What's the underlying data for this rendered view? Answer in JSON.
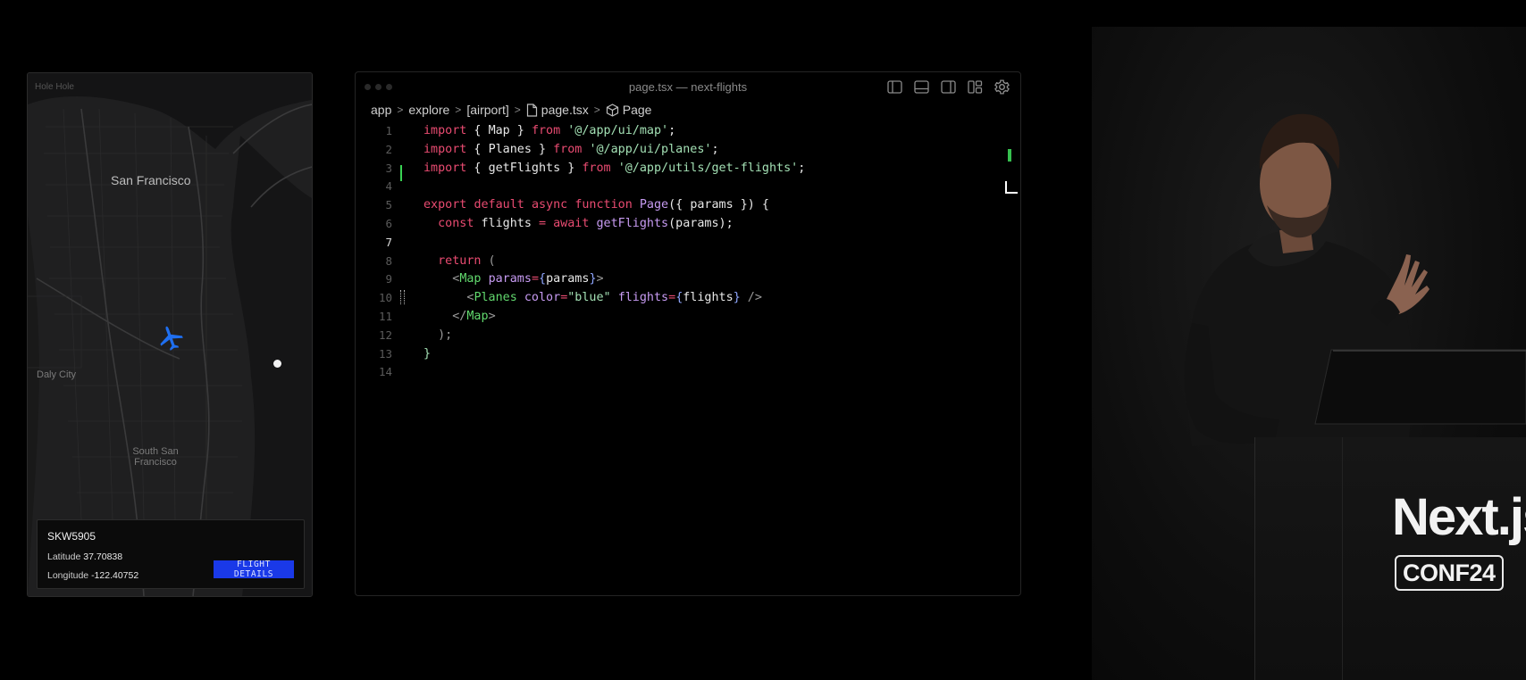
{
  "map": {
    "corner_label": "Hole Hole",
    "city_sf": "San Francisco",
    "city_daly": "Daly City",
    "city_ssf": "South San Francisco",
    "plane_icon": "airplane-icon",
    "flight": {
      "id": "SKW5905",
      "latitude_label": "Latitude",
      "latitude_value": "37.70838",
      "longitude_label": "Longitude",
      "longitude_value": "-122.40752",
      "details_button": "FLIGHT DETAILS"
    }
  },
  "editor": {
    "title": "page.tsx — next-flights",
    "layout_icons": [
      "sidebar-left-icon",
      "panel-bottom-icon",
      "sidebar-right-icon",
      "layout-customize-icon",
      "gear-icon"
    ],
    "breadcrumb": {
      "seg1": "app",
      "seg2": "explore",
      "seg3": "[airport]",
      "seg4": "page.tsx",
      "seg5": "Page"
    },
    "current_line": 7,
    "lines": [
      {
        "n": "1",
        "tokens": [
          {
            "t": "import",
            "c": "kw"
          },
          {
            "t": " { ",
            "c": "plain"
          },
          {
            "t": "Map",
            "c": "plain"
          },
          {
            "t": " } ",
            "c": "plain"
          },
          {
            "t": "from",
            "c": "kw"
          },
          {
            "t": " ",
            "c": "plain"
          },
          {
            "t": "'@/app/ui/map'",
            "c": "str"
          },
          {
            "t": ";",
            "c": "plain"
          }
        ]
      },
      {
        "n": "2",
        "tokens": [
          {
            "t": "import",
            "c": "kw"
          },
          {
            "t": " { ",
            "c": "plain"
          },
          {
            "t": "Planes",
            "c": "plain"
          },
          {
            "t": " } ",
            "c": "plain"
          },
          {
            "t": "from",
            "c": "kw"
          },
          {
            "t": " ",
            "c": "plain"
          },
          {
            "t": "'@/app/ui/planes'",
            "c": "str"
          },
          {
            "t": ";",
            "c": "plain"
          }
        ]
      },
      {
        "n": "3",
        "tokens": [
          {
            "t": "import",
            "c": "kw"
          },
          {
            "t": " { ",
            "c": "plain"
          },
          {
            "t": "getFlights",
            "c": "plain"
          },
          {
            "t": " } ",
            "c": "plain"
          },
          {
            "t": "from",
            "c": "kw"
          },
          {
            "t": " ",
            "c": "plain"
          },
          {
            "t": "'@/app/utils/get-flights'",
            "c": "str"
          },
          {
            "t": ";",
            "c": "plain"
          }
        ]
      },
      {
        "n": "4",
        "tokens": []
      },
      {
        "n": "5",
        "tokens": [
          {
            "t": "export",
            "c": "kw"
          },
          {
            "t": " ",
            "c": "plain"
          },
          {
            "t": "default",
            "c": "kw"
          },
          {
            "t": " ",
            "c": "plain"
          },
          {
            "t": "async",
            "c": "kw"
          },
          {
            "t": " ",
            "c": "plain"
          },
          {
            "t": "function",
            "c": "kw"
          },
          {
            "t": " ",
            "c": "plain"
          },
          {
            "t": "Page",
            "c": "fn"
          },
          {
            "t": "({ ",
            "c": "plain"
          },
          {
            "t": "params",
            "c": "plain"
          },
          {
            "t": " }) {",
            "c": "plain"
          }
        ]
      },
      {
        "n": "6",
        "tokens": [
          {
            "t": "  ",
            "c": "plain"
          },
          {
            "t": "const",
            "c": "kw"
          },
          {
            "t": " flights ",
            "c": "plain"
          },
          {
            "t": "=",
            "c": "kw"
          },
          {
            "t": " ",
            "c": "plain"
          },
          {
            "t": "await",
            "c": "kw"
          },
          {
            "t": " ",
            "c": "plain"
          },
          {
            "t": "getFlights",
            "c": "fn"
          },
          {
            "t": "(params);",
            "c": "plain"
          }
        ]
      },
      {
        "n": "7",
        "tokens": []
      },
      {
        "n": "8",
        "tokens": [
          {
            "t": "  ",
            "c": "plain"
          },
          {
            "t": "return",
            "c": "kw"
          },
          {
            "t": " (",
            "c": "dim"
          }
        ]
      },
      {
        "n": "9",
        "tokens": [
          {
            "t": "    <",
            "c": "dim"
          },
          {
            "t": "Map",
            "c": "tag"
          },
          {
            "t": " ",
            "c": "plain"
          },
          {
            "t": "params",
            "c": "attr"
          },
          {
            "t": "=",
            "c": "kw"
          },
          {
            "t": "{",
            "c": "pun"
          },
          {
            "t": "params",
            "c": "plain"
          },
          {
            "t": "}",
            "c": "pun"
          },
          {
            "t": ">",
            "c": "dim"
          }
        ]
      },
      {
        "n": "10",
        "tokens": [
          {
            "t": "      <",
            "c": "dim"
          },
          {
            "t": "Planes",
            "c": "tag"
          },
          {
            "t": " ",
            "c": "plain"
          },
          {
            "t": "color",
            "c": "attr"
          },
          {
            "t": "=",
            "c": "kw"
          },
          {
            "t": "\"blue\"",
            "c": "str"
          },
          {
            "t": " ",
            "c": "plain"
          },
          {
            "t": "flights",
            "c": "attr"
          },
          {
            "t": "=",
            "c": "kw"
          },
          {
            "t": "{",
            "c": "pun"
          },
          {
            "t": "flights",
            "c": "plain"
          },
          {
            "t": "}",
            "c": "pun"
          },
          {
            "t": " />",
            "c": "dim"
          }
        ]
      },
      {
        "n": "11",
        "tokens": [
          {
            "t": "    </",
            "c": "dim"
          },
          {
            "t": "Map",
            "c": "tag"
          },
          {
            "t": ">",
            "c": "dim"
          }
        ]
      },
      {
        "n": "12",
        "tokens": [
          {
            "t": "  );",
            "c": "dim"
          }
        ]
      },
      {
        "n": "13",
        "tokens": [
          {
            "t": "}",
            "c": "str"
          }
        ]
      },
      {
        "n": "14",
        "tokens": []
      }
    ]
  },
  "stage": {
    "logo": "Next.js",
    "badge": "CONF24"
  }
}
